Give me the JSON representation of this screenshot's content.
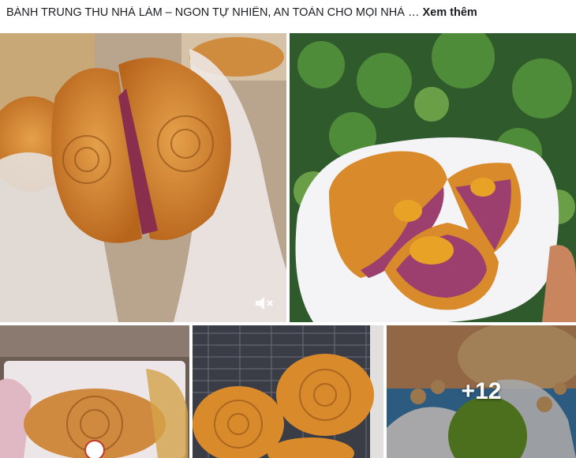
{
  "post": {
    "caption_text": "BÁNH TRUNG THU NHÀ LÀM – NGON TỰ NHIÊN, AN TOÀN CHO MỌI NHÀ …",
    "see_more_label": "Xem thêm"
  },
  "gallery": {
    "video_mute_icon": "speaker-muted-icon",
    "more_count_label": "+12"
  },
  "colors": {
    "caption_text": "#1c1e21",
    "mooncake_gold": "#d98a2b",
    "ube_purple": "#9c3f6f",
    "egg_yolk": "#e8a327"
  }
}
